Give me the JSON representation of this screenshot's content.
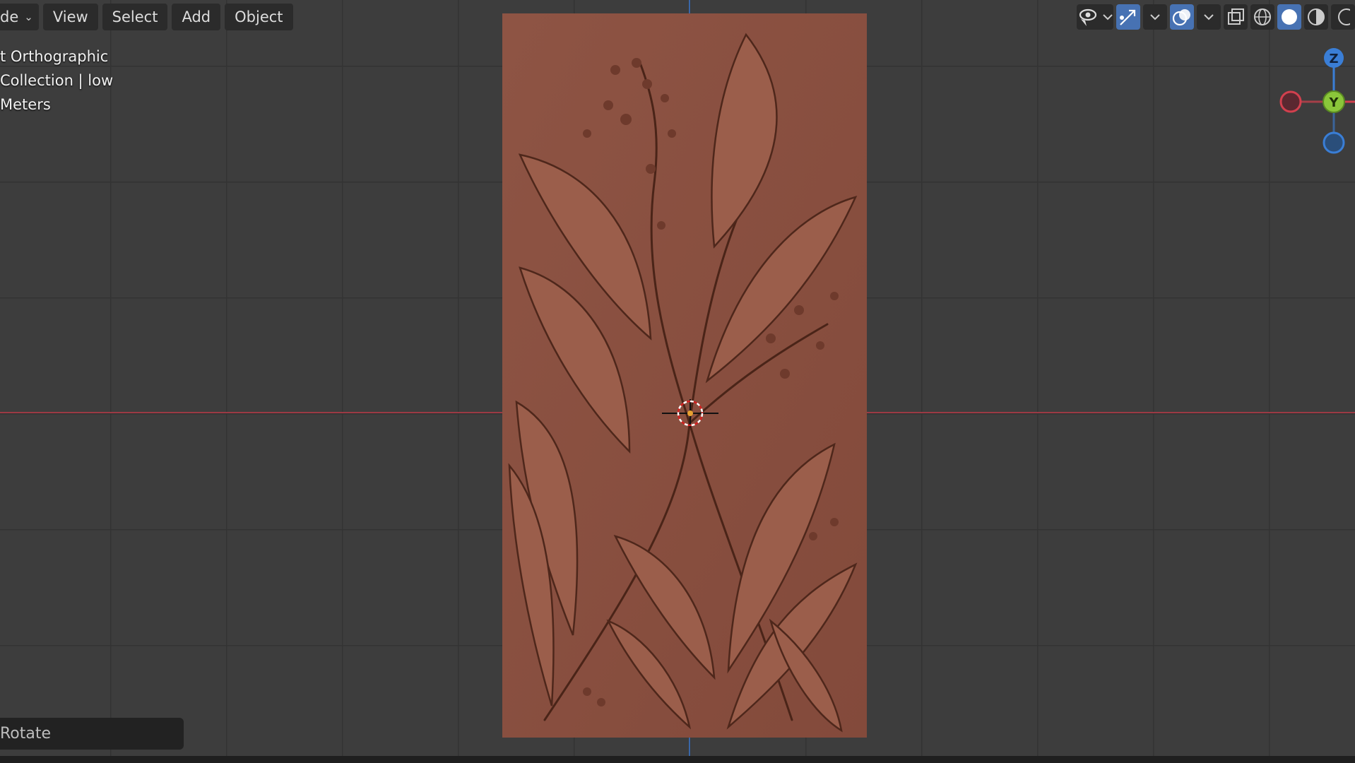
{
  "header": {
    "mode_label": "de",
    "menus": [
      "View",
      "Select",
      "Add",
      "Object"
    ]
  },
  "overlay": {
    "view_name": "t Orthographic",
    "collection": "Collection | low",
    "units": "Meters"
  },
  "gizmo": {
    "z_label": "Z",
    "y_label": "Y"
  },
  "operator_panel": {
    "label": "Rotate"
  },
  "toolbar": {
    "icons": [
      "visibility-icon",
      "gizmo-toggle-icon",
      "overlay-toggle-icon",
      "xray-icon",
      "wireframe-shading-icon",
      "solid-shading-icon",
      "material-shading-icon",
      "rendered-shading-icon"
    ]
  },
  "colors": {
    "viewport_bg": "#3d3d3d",
    "grid": "#333333",
    "x_axis": "#9b3a44",
    "y_axis": "#3a67a8",
    "relief": "#8a5141",
    "accent": "#4772b3",
    "gizmo_z": "#3a7ed6",
    "gizmo_y": "#8ac63a",
    "gizmo_x": "#d2404e"
  }
}
